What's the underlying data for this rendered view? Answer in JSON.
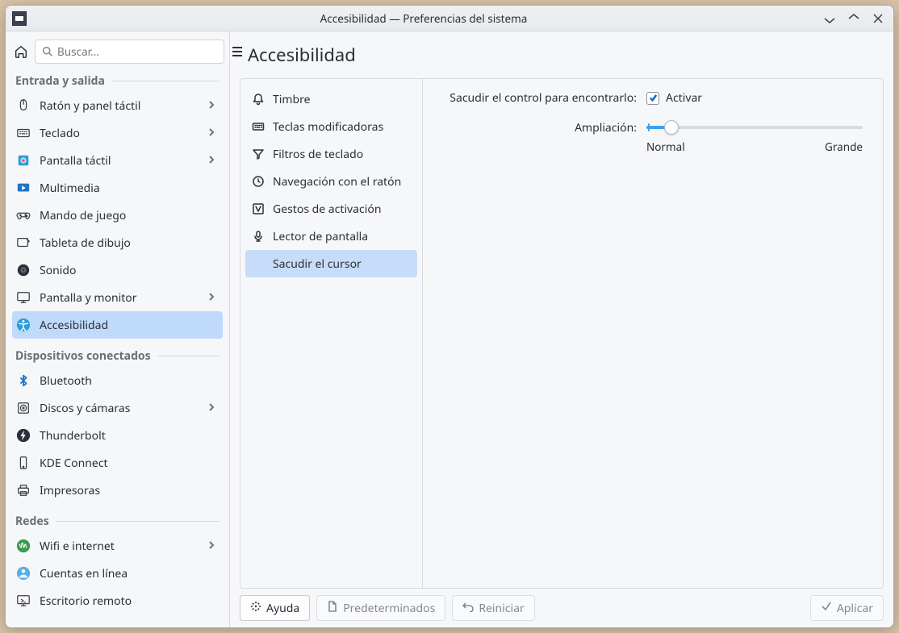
{
  "titlebar": {
    "title": "Accesibilidad — Preferencias del sistema"
  },
  "search": {
    "placeholder": "Buscar..."
  },
  "sidebar": {
    "sections": [
      {
        "title": "Entrada y salida",
        "items": [
          {
            "label": "Ratón y panel táctil",
            "chevron": true,
            "icon": "mouse"
          },
          {
            "label": "Teclado",
            "chevron": true,
            "icon": "keyboard"
          },
          {
            "label": "Pantalla táctil",
            "chevron": true,
            "icon": "touch"
          },
          {
            "label": "Multimedia",
            "chevron": false,
            "icon": "multimedia"
          },
          {
            "label": "Mando de juego",
            "chevron": false,
            "icon": "gamepad"
          },
          {
            "label": "Tableta de dibujo",
            "chevron": false,
            "icon": "tablet"
          },
          {
            "label": "Sonido",
            "chevron": false,
            "icon": "sound"
          },
          {
            "label": "Pantalla y monitor",
            "chevron": true,
            "icon": "monitor"
          },
          {
            "label": "Accesibilidad",
            "chevron": false,
            "icon": "a11y",
            "active": true
          }
        ]
      },
      {
        "title": "Dispositivos conectados",
        "items": [
          {
            "label": "Bluetooth",
            "chevron": false,
            "icon": "bluetooth"
          },
          {
            "label": "Discos y cámaras",
            "chevron": true,
            "icon": "disk"
          },
          {
            "label": "Thunderbolt",
            "chevron": false,
            "icon": "thunderbolt"
          },
          {
            "label": "KDE Connect",
            "chevron": false,
            "icon": "kdeconnect"
          },
          {
            "label": "Impresoras",
            "chevron": false,
            "icon": "printer"
          }
        ]
      },
      {
        "title": "Redes",
        "items": [
          {
            "label": "Wifi e internet",
            "chevron": true,
            "icon": "wifi"
          },
          {
            "label": "Cuentas en línea",
            "chevron": false,
            "icon": "accounts"
          },
          {
            "label": "Escritorio remoto",
            "chevron": false,
            "icon": "remote"
          }
        ]
      }
    ]
  },
  "content": {
    "title": "Accesibilidad",
    "subnav": [
      {
        "label": "Timbre",
        "icon": "bell"
      },
      {
        "label": "Teclas modificadoras",
        "icon": "keyboard"
      },
      {
        "label": "Filtros de teclado",
        "icon": "filter"
      },
      {
        "label": "Navegación con el ratón",
        "icon": "clock-mouse"
      },
      {
        "label": "Gestos de activación",
        "icon": "gesture"
      },
      {
        "label": "Lector de pantalla",
        "icon": "mic"
      },
      {
        "label": "Sacudir el cursor",
        "icon": "cursor",
        "active": true
      }
    ],
    "pane": {
      "shake_label": "Sacudir el control para encontrarlo:",
      "activate_label": "Activar",
      "activate_checked": true,
      "magnify_label": "Ampliación:",
      "slider_min_label": "Normal",
      "slider_max_label": "Grande",
      "slider_value_percent": 10
    }
  },
  "footer": {
    "help": "Ayuda",
    "defaults": "Predeterminados",
    "reset": "Reiniciar",
    "apply": "Aplicar"
  }
}
